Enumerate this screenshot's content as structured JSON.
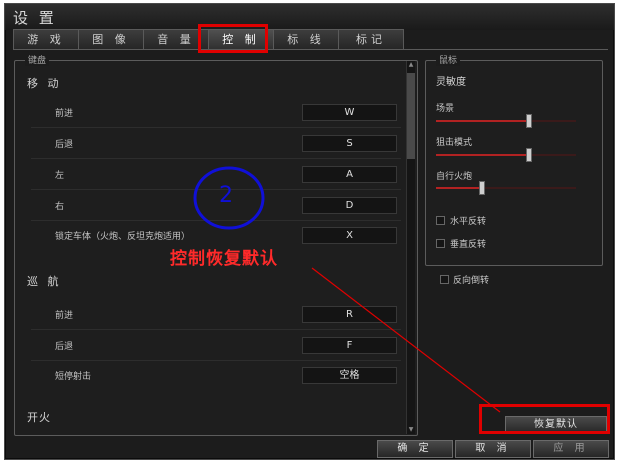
{
  "window": {
    "title": "设 置"
  },
  "tabs": [
    {
      "label": "游 戏",
      "active": false
    },
    {
      "label": "图 像",
      "active": false
    },
    {
      "label": "音 量",
      "active": false
    },
    {
      "label": "控 制",
      "active": true
    },
    {
      "label": "标 线",
      "active": false
    },
    {
      "label": "标记",
      "active": false
    }
  ],
  "keyboard": {
    "legend": "键盘",
    "sections": {
      "move": "移 动",
      "cruise": "巡 航",
      "fire": "开火"
    },
    "rows": [
      {
        "label": "前进",
        "key": "W"
      },
      {
        "label": "后退",
        "key": "S"
      },
      {
        "label": "左",
        "key": "A"
      },
      {
        "label": "右",
        "key": "D"
      },
      {
        "label": "锁定车体（火炮、反坦克炮适用）",
        "key": "X"
      },
      {
        "label": "前进",
        "key": "R"
      },
      {
        "label": "后退",
        "key": "F"
      },
      {
        "label": "短停射击",
        "key": "空格"
      }
    ]
  },
  "mouse": {
    "legend": "鼠标",
    "sensitivity_label": "灵敏度",
    "sliders": [
      {
        "label": "场景",
        "value": 0.66
      },
      {
        "label": "狙击模式",
        "value": 0.66
      },
      {
        "label": "自行火炮",
        "value": 0.32
      }
    ],
    "checkboxes": [
      {
        "label": "水平反转",
        "checked": false
      },
      {
        "label": "垂直反转",
        "checked": false
      },
      {
        "label": "反向倒转",
        "checked": false
      }
    ]
  },
  "buttons": {
    "restore": "恢复默认",
    "ok": "确 定",
    "cancel": "取 消",
    "apply": "应 用"
  },
  "annotation": {
    "step_number": "2",
    "caption": "控制恢复默认"
  },
  "colors": {
    "annotation_red": "#e00000",
    "annotation_blue": "#1010d8",
    "slider_red": "#b22222"
  }
}
